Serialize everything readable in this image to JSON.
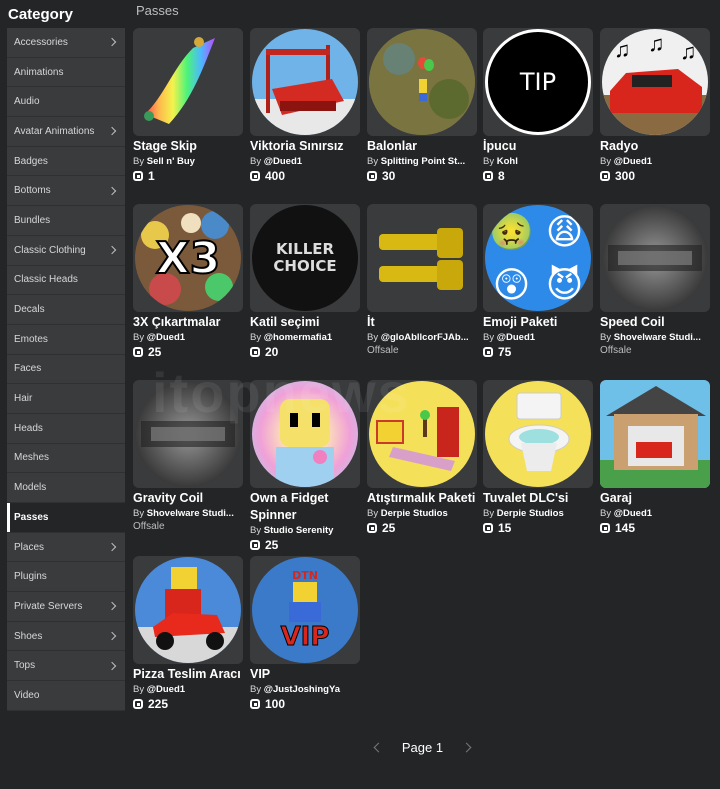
{
  "sidebar": {
    "title": "Category",
    "items": [
      {
        "label": "Accessories",
        "chevron": true
      },
      {
        "label": "Animations",
        "chevron": false
      },
      {
        "label": "Audio",
        "chevron": false
      },
      {
        "label": "Avatar Animations",
        "chevron": true
      },
      {
        "label": "Badges",
        "chevron": false
      },
      {
        "label": "Bottoms",
        "chevron": true
      },
      {
        "label": "Bundles",
        "chevron": false
      },
      {
        "label": "Classic Clothing",
        "chevron": true
      },
      {
        "label": "Classic Heads",
        "chevron": false
      },
      {
        "label": "Decals",
        "chevron": false
      },
      {
        "label": "Emotes",
        "chevron": false
      },
      {
        "label": "Faces",
        "chevron": false
      },
      {
        "label": "Hair",
        "chevron": false
      },
      {
        "label": "Heads",
        "chevron": false
      },
      {
        "label": "Meshes",
        "chevron": false
      },
      {
        "label": "Models",
        "chevron": false
      },
      {
        "label": "Passes",
        "chevron": false,
        "active": true
      },
      {
        "label": "Places",
        "chevron": true
      },
      {
        "label": "Plugins",
        "chevron": false
      },
      {
        "label": "Private Servers",
        "chevron": true
      },
      {
        "label": "Shoes",
        "chevron": true
      },
      {
        "label": "Tops",
        "chevron": true
      },
      {
        "label": "Video",
        "chevron": false
      }
    ]
  },
  "section_title": "Passes",
  "items": [
    {
      "name": "Stage Skip",
      "by_prefix": "By",
      "creator": "Sell n' Buy",
      "price": "1",
      "icon": "rainbow-carpet"
    },
    {
      "name": "Viktoria Sınırsız",
      "by_prefix": "By",
      "creator": "@Dued1",
      "price": "400",
      "icon": "red-bed"
    },
    {
      "name": "Balonlar",
      "by_prefix": "By",
      "creator": "Splitting Point St...",
      "price": "30",
      "icon": "balloons"
    },
    {
      "name": "İpucu",
      "by_prefix": "By",
      "creator": "Kohl",
      "price": "8",
      "icon": "tip",
      "icon_text": "TIP"
    },
    {
      "name": "Radyo",
      "by_prefix": "By",
      "creator": "@Dued1",
      "price": "300",
      "icon": "red-car-music"
    },
    {
      "name": "3X Çıkartmalar",
      "by_prefix": "By",
      "creator": "@Dued1",
      "price": "25",
      "icon": "x3-stickers",
      "icon_text": "X3"
    },
    {
      "name": "Katil seçimi",
      "by_prefix": "By",
      "creator": "@homermafia1",
      "price": "20",
      "icon": "killer-choice",
      "icon_text": "KILLER CHOICE"
    },
    {
      "name": "İt",
      "by_prefix": "By",
      "creator": "@gloAbllcorFJAb...",
      "offsale": "Offsale",
      "icon": "yellow-hands"
    },
    {
      "name": "Emoji Paketi",
      "by_prefix": "By",
      "creator": "@Dued1",
      "price": "75",
      "icon": "emojis"
    },
    {
      "name": "Speed Coil",
      "by_prefix": "By",
      "creator": "Shovelware Studi...",
      "offsale": "Offsale",
      "icon": "coil"
    },
    {
      "name": "Gravity Coil",
      "by_prefix": "By",
      "creator": "Shovelware Studi...",
      "offsale": "Offsale",
      "icon": "coil"
    },
    {
      "name": "Own a Fidget Spinner",
      "by_prefix": "By",
      "creator": "Studio Serenity",
      "price": "25",
      "icon": "fidget-face"
    },
    {
      "name": "Atıştırmalık Paketi",
      "by_prefix": "By",
      "creator": "Derpie Studios",
      "price": "25",
      "icon": "snacks"
    },
    {
      "name": "Tuvalet DLC'si",
      "by_prefix": "By",
      "creator": "Derpie Studios",
      "price": "15",
      "icon": "toilet"
    },
    {
      "name": "Garaj",
      "by_prefix": "By",
      "creator": "@Dued1",
      "price": "145",
      "icon": "garage"
    },
    {
      "name": "Pizza Teslim Aracı",
      "by_prefix": "By",
      "creator": "@Dued1",
      "price": "225",
      "icon": "pizza-scooter"
    },
    {
      "name": "VIP",
      "by_prefix": "By",
      "creator": "@JustJoshingYa",
      "price": "100",
      "icon": "vip",
      "icon_text": "VIP",
      "icon_subtext": "DTN"
    }
  ],
  "pager": {
    "label": "Page 1"
  },
  "watermark": "itopnews"
}
